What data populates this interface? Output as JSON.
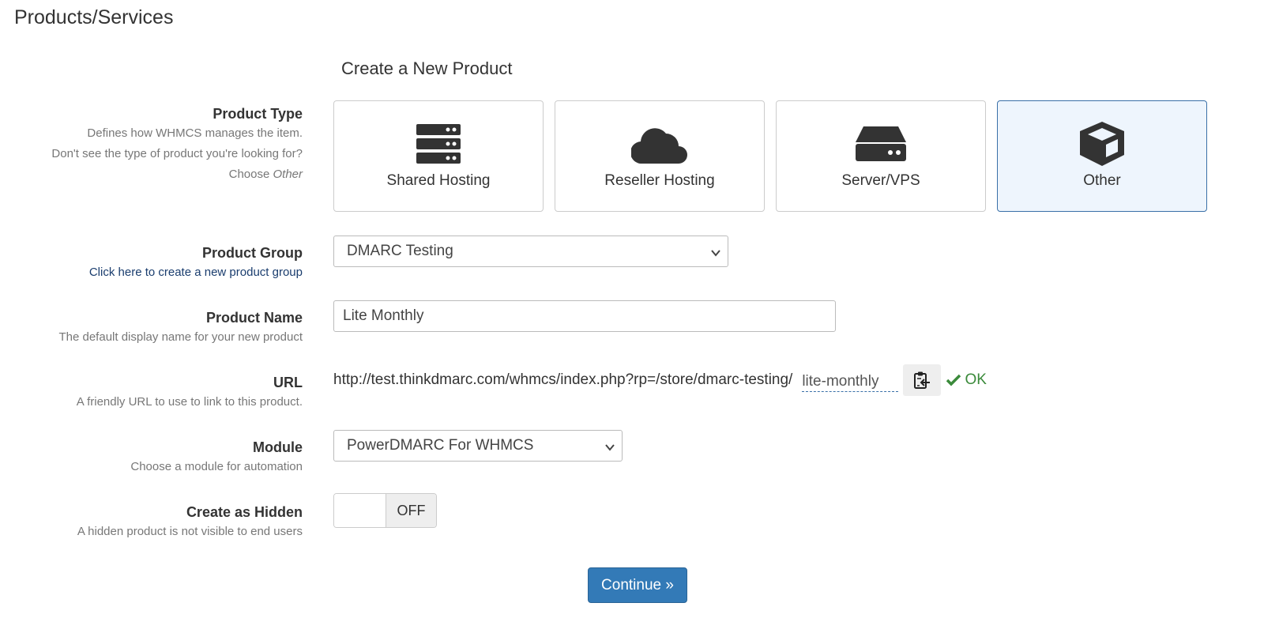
{
  "page": {
    "title": "Products/Services"
  },
  "form": {
    "title": "Create a New Product",
    "product_type": {
      "label": "Product Type",
      "desc_line1": "Defines how WHMCS manages the item.",
      "desc_line2": "Don't see the type of product you're looking for?",
      "desc_choose": "Choose",
      "desc_other": "Other",
      "options": [
        {
          "label": "Shared Hosting",
          "icon": "server-stack-icon",
          "selected": false
        },
        {
          "label": "Reseller Hosting",
          "icon": "cloud-icon",
          "selected": false
        },
        {
          "label": "Server/VPS",
          "icon": "server-icon",
          "selected": false
        },
        {
          "label": "Other",
          "icon": "cube-icon",
          "selected": true
        }
      ]
    },
    "product_group": {
      "label": "Product Group",
      "link": "Click here to create a new product group",
      "value": "DMARC Testing"
    },
    "product_name": {
      "label": "Product Name",
      "desc": "The default display name for your new product",
      "value": "Lite Monthly"
    },
    "url": {
      "label": "URL",
      "desc": "A friendly URL to use to link to this product.",
      "prefix": "http://test.thinkdmarc.com/whmcs/index.php?rp=/store/dmarc-testing/",
      "slug": "lite-monthly",
      "status": "OK"
    },
    "module": {
      "label": "Module",
      "desc": "Choose a module for automation",
      "value": "PowerDMARC For WHMCS"
    },
    "hidden": {
      "label": "Create as Hidden",
      "desc": "A hidden product is not visible to end users",
      "state": "OFF"
    },
    "continue_label": "Continue »"
  },
  "colors": {
    "primary": "#337ab7",
    "selected_bg": "#eef5fd",
    "ok": "#3a8a3a"
  }
}
